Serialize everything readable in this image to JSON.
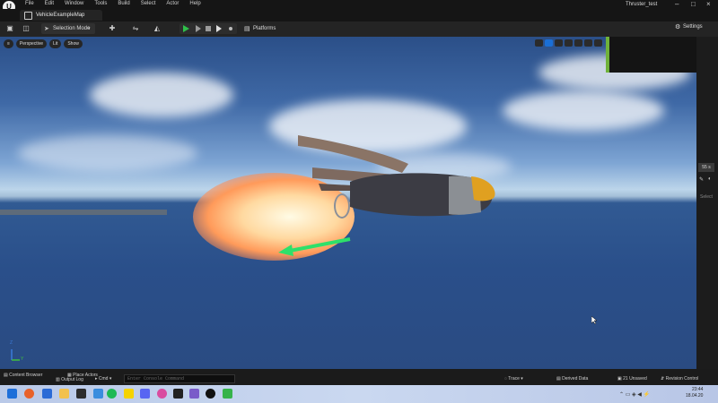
{
  "menubar": {
    "items": [
      "File",
      "Edit",
      "Window",
      "Tools",
      "Build",
      "Select",
      "Actor",
      "Help"
    ],
    "project_name": "Thruster_test"
  },
  "tabs": {
    "map_tab": "VehicleExampleMap"
  },
  "toolbar": {
    "selection_mode": "Selection Mode",
    "platforms": "Platforms",
    "settings": "Settings"
  },
  "viewport": {
    "perspective": "Perspective",
    "lit": "Lit",
    "show": "Show",
    "speed": "55 s",
    "select_label": "Select",
    "axis_x": "Y",
    "axis_z": "Z"
  },
  "bottombar": {
    "content_browser": "Content Browser",
    "output_log": "Output Log",
    "cmd": "Cmd",
    "console_placeholder": "Enter Console Command",
    "place_actors": "Place Actors",
    "trace": "Trace",
    "derived_data": "Derived Data",
    "unsaved": "21 Unsaved",
    "revision_control": "Revision Control"
  },
  "taskbar": {
    "time": "23:44",
    "date": "18.04.20"
  },
  "colors": {
    "accent": "#1a6fd6",
    "play": "#2fbf4a",
    "flame": "#ffb470"
  }
}
